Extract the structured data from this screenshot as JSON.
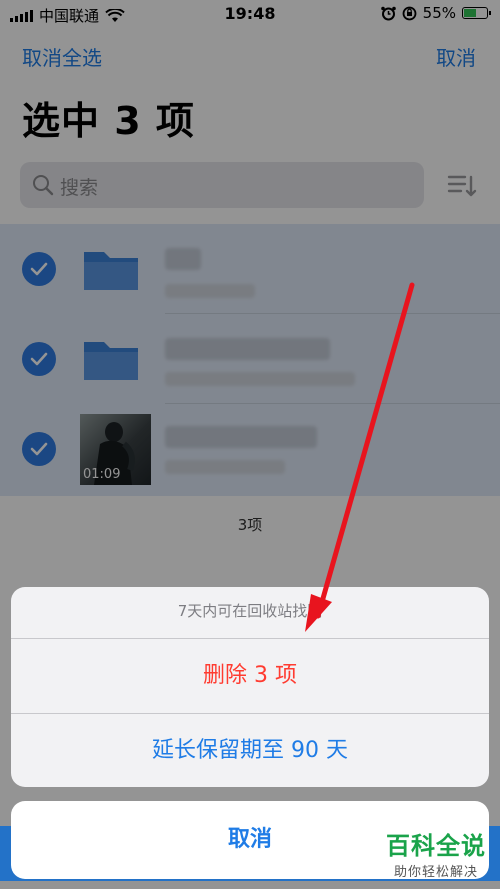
{
  "status_bar": {
    "carrier": "中国联通",
    "time": "19:48",
    "battery": "55%",
    "battery_level": 0.55
  },
  "nav": {
    "left": "取消全选",
    "right": "取消"
  },
  "page_title": "选中 3 项",
  "search": {
    "placeholder": "搜索"
  },
  "list": {
    "items": [
      {
        "type": "folder",
        "selected": true
      },
      {
        "type": "folder",
        "selected": true
      },
      {
        "type": "video",
        "selected": true,
        "duration": "01:09"
      }
    ],
    "count_label": "3项"
  },
  "action_sheet": {
    "message": "7天内可在回收站找回",
    "delete_label": "删除 3 项",
    "extend_label": "延长保留期至 90 天",
    "cancel_label": "取消"
  },
  "watermark": {
    "main": "百科全说",
    "sub": "助你轻松解决"
  },
  "colors": {
    "accent": "#1f7ce6",
    "destructive": "#ff3b30",
    "check": "#2f7be2",
    "folder": "#3c82d8",
    "arrow": "#e8141e",
    "watermark": "#1aa34a"
  },
  "icons": [
    "wifi-icon",
    "alarm-icon",
    "rotation-lock-icon",
    "battery-icon",
    "search-icon",
    "sort-icon",
    "folder-icon",
    "checkmark-icon"
  ]
}
